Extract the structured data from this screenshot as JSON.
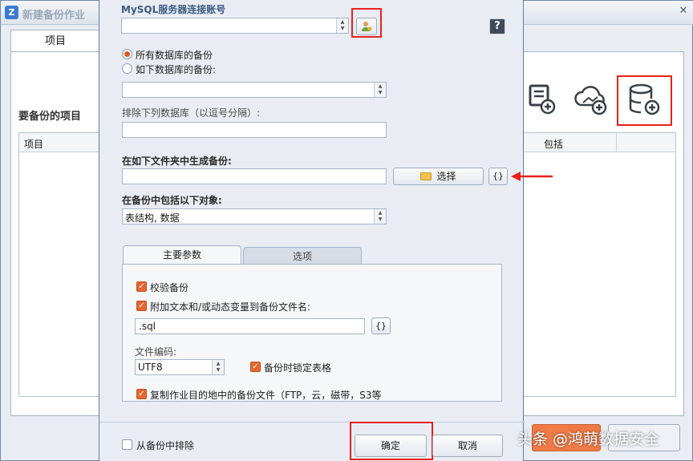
{
  "background_window": {
    "title": "新建备份作业",
    "tab_label": "项目",
    "section_title": "要备份的项目",
    "grid_headers": [
      "项目",
      "包括"
    ]
  },
  "dialog": {
    "account_label": "MySQL服务器连接账号",
    "account_value": "",
    "help_label": "?",
    "radio_all": "所有数据库的备份",
    "radio_selected": "如下数据库的备份:",
    "radio_all_checked": true,
    "databases_value": "",
    "exclude_label": "排除下列数据库（以逗号分隔）:",
    "exclude_value": "",
    "folder_label": "在如下文件夹中生成备份:",
    "folder_value": "",
    "browse_label": "选择",
    "macro_label": "{}",
    "objects_label": "在备份中包括以下对象:",
    "objects_value": "表结构, 数据",
    "tabs": [
      "主要参数",
      "选项"
    ],
    "verify_backup": "校验备份",
    "append_text": "附加文本和/或动态变量到备份文件名:",
    "suffix_value": ".sql",
    "suffix_macro": "{}",
    "encoding_label": "文件编码:",
    "encoding_value": "UTF8",
    "lock_tables": "备份时锁定表格",
    "copy_dest": "复制作业目的地中的备份文件（FTP，云，磁带，S3等",
    "exclude_from_backup": "从备份中排除",
    "ok_label": "确定",
    "cancel_label": "取消"
  },
  "watermark": "头条 @鸿萌数据安全",
  "colors": {
    "accent": "#e8652f",
    "highlight_box": "#e8211a",
    "background_blue": "#1e4f8f"
  }
}
